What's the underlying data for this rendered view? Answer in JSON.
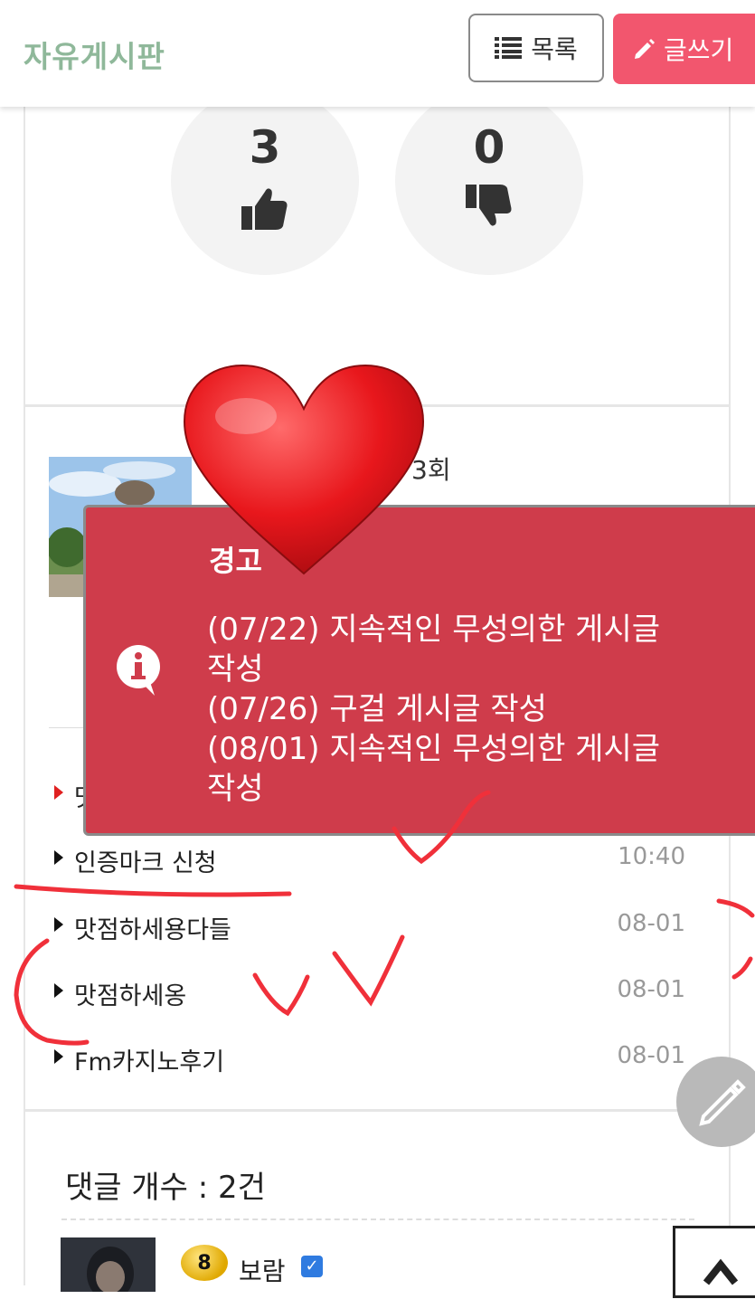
{
  "header": {
    "title": "자유게시판",
    "list_label": "목록",
    "write_label": "글쓰기"
  },
  "votes": {
    "likes": "3",
    "dislikes": "0"
  },
  "profile": {
    "views_suffix": "3회"
  },
  "warning": {
    "title": "경고",
    "lines": [
      "(07/22) 지속적인 무성의한 게시글",
      "작성",
      "(07/26) 구걸 게시글 작성",
      "(08/01) 지속적인 무성의한 게시글",
      "작성"
    ],
    "close": "×"
  },
  "posts": [
    {
      "label": "맛",
      "date": ""
    },
    {
      "label": "인증마크 신청",
      "date": "10:40"
    },
    {
      "label": "맛점하세용다들",
      "date": "08-01"
    },
    {
      "label": "맛점하세옹",
      "date": "08-01"
    },
    {
      "label": "Fm카지노후기",
      "date": "08-01"
    }
  ],
  "comments": {
    "title": "댓글 개수 : 2건",
    "first": {
      "level": "8",
      "name": "보람",
      "check": "✓"
    }
  },
  "colors": {
    "accent": "#f2566e",
    "title_green": "#8fb89a",
    "warning_bg": "#cf3c4b"
  }
}
